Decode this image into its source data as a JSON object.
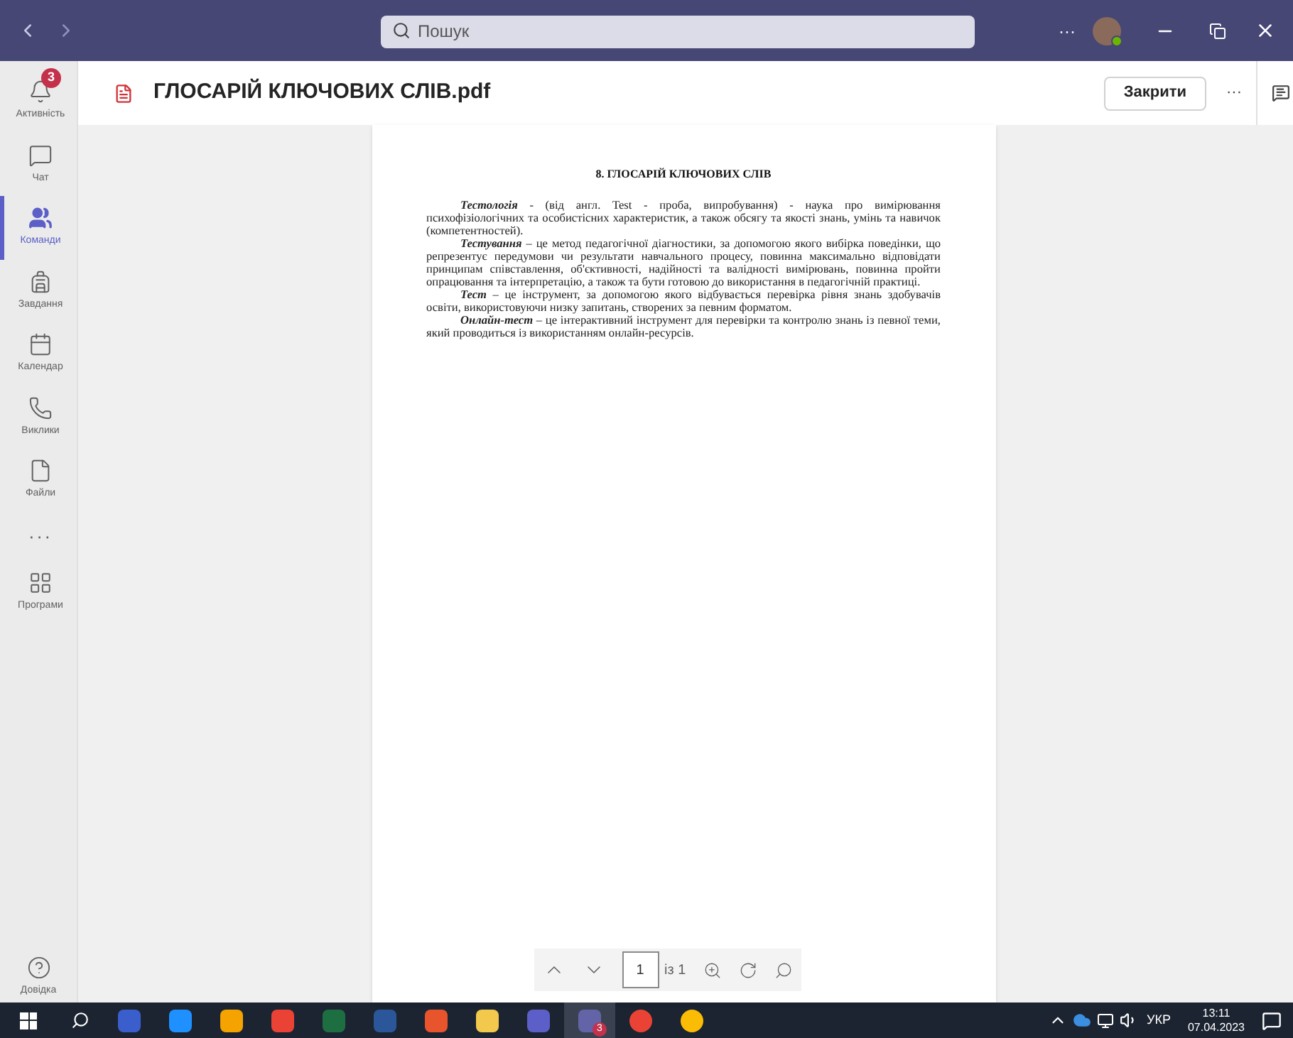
{
  "titlebar": {
    "search_placeholder": "Пошук",
    "more": "···"
  },
  "rail": [
    {
      "label": "Активність",
      "selected": false,
      "badge": "3"
    },
    {
      "label": "Чат",
      "selected": false
    },
    {
      "label": "Команди",
      "selected": true
    },
    {
      "label": "Завдання",
      "selected": false
    },
    {
      "label": "Календар",
      "selected": false
    },
    {
      "label": "Виклики",
      "selected": false
    },
    {
      "label": "Файли",
      "selected": false
    },
    {
      "label": "···",
      "selected": false,
      "kind": "more"
    },
    {
      "label": "Програми",
      "selected": false
    }
  ],
  "rail_bottom": {
    "label": "Довідка"
  },
  "header": {
    "title": "ГЛОСАРІЙ КЛЮЧОВИХ СЛІВ.pdf",
    "close": "Закрити",
    "more": "···"
  },
  "document": {
    "heading": "8. ГЛОСАРІЙ КЛЮЧОВИХ СЛІВ",
    "paragraphs": [
      "*Тестологія* - (від англ. Test - проба, випробування) - наука про вимірювання психофізіологічних та особистісних характеристик, а також обсягу та якості знань, умінь та навичок (компетентностей).",
      "*Тестування* – це метод педагогічної діагностики, за допомогою якого вибірка поведінки, що репрезентує передумови чи результати навчального процесу, повинна максимально відповідати принципам співставлення, об'єктивності, надійності та валідності вимірювань, повинна пройти опрацювання та інтерпретацію, а також та бути готовою до використання в педагогічній практиці.",
      "*Тест* – це інструмент, за допомогою якого відбувається перевірка рівня знань здобувачів освіти, використовуючи низку запитань, створених за певним форматом.",
      "*Онлайн-тест* – це інтерактивний інструмент для перевірки та контролю знань із певної теми, який проводиться із використанням онлайн-ресурсів."
    ]
  },
  "pager": {
    "page": "1",
    "of": "із 1"
  },
  "taskbar": {
    "teams_badge": "3",
    "language": "УКР",
    "time": "13:11",
    "date": "07.04.2023"
  }
}
